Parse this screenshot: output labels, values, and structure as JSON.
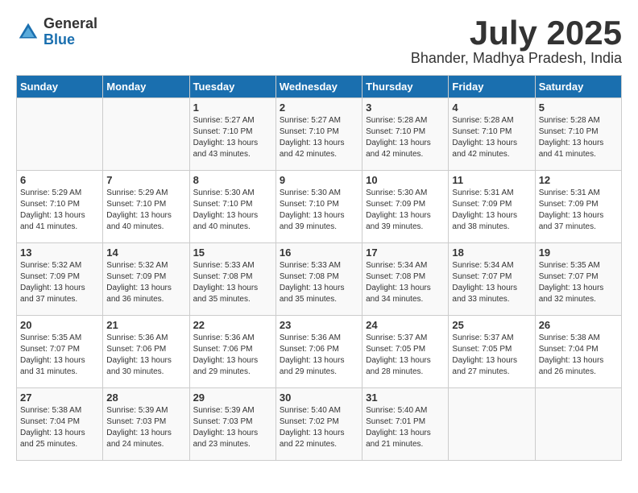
{
  "header": {
    "logo": {
      "general": "General",
      "blue": "Blue"
    },
    "month": "July 2025",
    "location": "Bhander, Madhya Pradesh, India"
  },
  "weekdays": [
    "Sunday",
    "Monday",
    "Tuesday",
    "Wednesday",
    "Thursday",
    "Friday",
    "Saturday"
  ],
  "weeks": [
    [
      {
        "day": "",
        "detail": ""
      },
      {
        "day": "",
        "detail": ""
      },
      {
        "day": "1",
        "detail": "Sunrise: 5:27 AM\nSunset: 7:10 PM\nDaylight: 13 hours\nand 43 minutes."
      },
      {
        "day": "2",
        "detail": "Sunrise: 5:27 AM\nSunset: 7:10 PM\nDaylight: 13 hours\nand 42 minutes."
      },
      {
        "day": "3",
        "detail": "Sunrise: 5:28 AM\nSunset: 7:10 PM\nDaylight: 13 hours\nand 42 minutes."
      },
      {
        "day": "4",
        "detail": "Sunrise: 5:28 AM\nSunset: 7:10 PM\nDaylight: 13 hours\nand 42 minutes."
      },
      {
        "day": "5",
        "detail": "Sunrise: 5:28 AM\nSunset: 7:10 PM\nDaylight: 13 hours\nand 41 minutes."
      }
    ],
    [
      {
        "day": "6",
        "detail": "Sunrise: 5:29 AM\nSunset: 7:10 PM\nDaylight: 13 hours\nand 41 minutes."
      },
      {
        "day": "7",
        "detail": "Sunrise: 5:29 AM\nSunset: 7:10 PM\nDaylight: 13 hours\nand 40 minutes."
      },
      {
        "day": "8",
        "detail": "Sunrise: 5:30 AM\nSunset: 7:10 PM\nDaylight: 13 hours\nand 40 minutes."
      },
      {
        "day": "9",
        "detail": "Sunrise: 5:30 AM\nSunset: 7:10 PM\nDaylight: 13 hours\nand 39 minutes."
      },
      {
        "day": "10",
        "detail": "Sunrise: 5:30 AM\nSunset: 7:09 PM\nDaylight: 13 hours\nand 39 minutes."
      },
      {
        "day": "11",
        "detail": "Sunrise: 5:31 AM\nSunset: 7:09 PM\nDaylight: 13 hours\nand 38 minutes."
      },
      {
        "day": "12",
        "detail": "Sunrise: 5:31 AM\nSunset: 7:09 PM\nDaylight: 13 hours\nand 37 minutes."
      }
    ],
    [
      {
        "day": "13",
        "detail": "Sunrise: 5:32 AM\nSunset: 7:09 PM\nDaylight: 13 hours\nand 37 minutes."
      },
      {
        "day": "14",
        "detail": "Sunrise: 5:32 AM\nSunset: 7:09 PM\nDaylight: 13 hours\nand 36 minutes."
      },
      {
        "day": "15",
        "detail": "Sunrise: 5:33 AM\nSunset: 7:08 PM\nDaylight: 13 hours\nand 35 minutes."
      },
      {
        "day": "16",
        "detail": "Sunrise: 5:33 AM\nSunset: 7:08 PM\nDaylight: 13 hours\nand 35 minutes."
      },
      {
        "day": "17",
        "detail": "Sunrise: 5:34 AM\nSunset: 7:08 PM\nDaylight: 13 hours\nand 34 minutes."
      },
      {
        "day": "18",
        "detail": "Sunrise: 5:34 AM\nSunset: 7:07 PM\nDaylight: 13 hours\nand 33 minutes."
      },
      {
        "day": "19",
        "detail": "Sunrise: 5:35 AM\nSunset: 7:07 PM\nDaylight: 13 hours\nand 32 minutes."
      }
    ],
    [
      {
        "day": "20",
        "detail": "Sunrise: 5:35 AM\nSunset: 7:07 PM\nDaylight: 13 hours\nand 31 minutes."
      },
      {
        "day": "21",
        "detail": "Sunrise: 5:36 AM\nSunset: 7:06 PM\nDaylight: 13 hours\nand 30 minutes."
      },
      {
        "day": "22",
        "detail": "Sunrise: 5:36 AM\nSunset: 7:06 PM\nDaylight: 13 hours\nand 29 minutes."
      },
      {
        "day": "23",
        "detail": "Sunrise: 5:36 AM\nSunset: 7:06 PM\nDaylight: 13 hours\nand 29 minutes."
      },
      {
        "day": "24",
        "detail": "Sunrise: 5:37 AM\nSunset: 7:05 PM\nDaylight: 13 hours\nand 28 minutes."
      },
      {
        "day": "25",
        "detail": "Sunrise: 5:37 AM\nSunset: 7:05 PM\nDaylight: 13 hours\nand 27 minutes."
      },
      {
        "day": "26",
        "detail": "Sunrise: 5:38 AM\nSunset: 7:04 PM\nDaylight: 13 hours\nand 26 minutes."
      }
    ],
    [
      {
        "day": "27",
        "detail": "Sunrise: 5:38 AM\nSunset: 7:04 PM\nDaylight: 13 hours\nand 25 minutes."
      },
      {
        "day": "28",
        "detail": "Sunrise: 5:39 AM\nSunset: 7:03 PM\nDaylight: 13 hours\nand 24 minutes."
      },
      {
        "day": "29",
        "detail": "Sunrise: 5:39 AM\nSunset: 7:03 PM\nDaylight: 13 hours\nand 23 minutes."
      },
      {
        "day": "30",
        "detail": "Sunrise: 5:40 AM\nSunset: 7:02 PM\nDaylight: 13 hours\nand 22 minutes."
      },
      {
        "day": "31",
        "detail": "Sunrise: 5:40 AM\nSunset: 7:01 PM\nDaylight: 13 hours\nand 21 minutes."
      },
      {
        "day": "",
        "detail": ""
      },
      {
        "day": "",
        "detail": ""
      }
    ]
  ]
}
